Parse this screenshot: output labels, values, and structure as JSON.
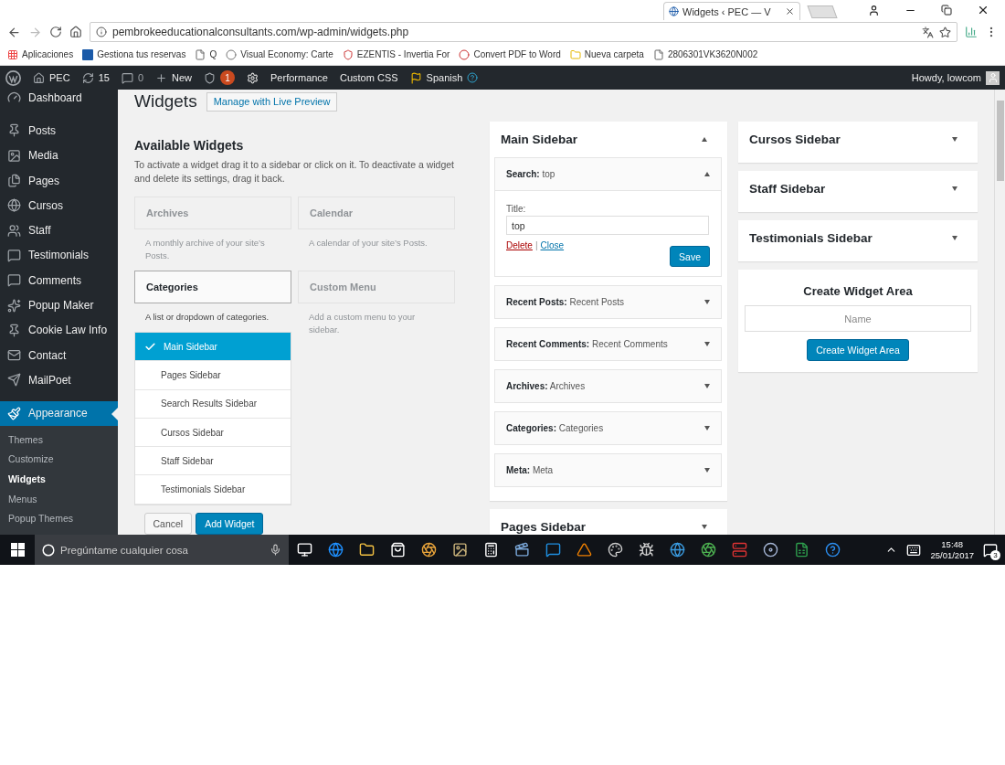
{
  "browser": {
    "tab_title": "Widgets ‹ PEC — V",
    "url": "pembrokeeducationalconsultants.com/wp-admin/widgets.php",
    "bookmarks": [
      "Aplicaciones",
      "Gestiona tus reservas",
      "Q",
      "Visual Economy: Carte",
      "EZENTIS - Invertia For",
      "Convert PDF to Word",
      "Nueva carpeta",
      "2806301VK3620N002"
    ]
  },
  "admin_bar": {
    "site": "PEC",
    "updates": "15",
    "comments": "0",
    "new": "New",
    "seo_badge": "1",
    "links": [
      "Performance",
      "Custom CSS"
    ],
    "language": "Spanish",
    "howdy": "Howdy, lowcom"
  },
  "menu": {
    "items": [
      {
        "label": "Dashboard",
        "selected": false
      },
      {
        "label": "Posts",
        "selected": false
      },
      {
        "label": "Media",
        "selected": false
      },
      {
        "label": "Pages",
        "selected": false
      },
      {
        "label": "Cursos",
        "selected": false
      },
      {
        "label": "Staff",
        "selected": false
      },
      {
        "label": "Testimonials",
        "selected": false
      },
      {
        "label": "Comments",
        "selected": false
      },
      {
        "label": "Popup Maker",
        "selected": false
      },
      {
        "label": "Cookie Law Info",
        "selected": false
      },
      {
        "label": "Contact",
        "selected": false
      },
      {
        "label": "MailPoet",
        "selected": false
      },
      {
        "label": "Appearance",
        "selected": true
      }
    ],
    "submenu": [
      {
        "label": "Themes",
        "selected": false
      },
      {
        "label": "Customize",
        "selected": false
      },
      {
        "label": "Widgets",
        "selected": true
      },
      {
        "label": "Menus",
        "selected": false
      },
      {
        "label": "Popup Themes",
        "selected": false
      }
    ]
  },
  "page": {
    "title": "Widgets",
    "live_preview": "Manage with Live Preview"
  },
  "available": {
    "title": "Available Widgets",
    "description": "To activate a widget drag it to a sidebar or click on it. To deactivate a widget and delete its settings, drag it back.",
    "widgets": [
      {
        "name": "Archives",
        "description": "A monthly archive of your site’s Posts.",
        "highlighted": false
      },
      {
        "name": "Calendar",
        "description": "A calendar of your site’s Posts.",
        "highlighted": false
      },
      {
        "name": "Categories",
        "description": "A list or dropdown of categories.",
        "highlighted": true
      },
      {
        "name": "Custom Menu",
        "description": "Add a custom menu to your sidebar.",
        "highlighted": false
      }
    ],
    "chooser": [
      {
        "label": "Main Sidebar",
        "selected": true
      },
      {
        "label": "Pages Sidebar",
        "selected": false
      },
      {
        "label": "Search Results Sidebar",
        "selected": false
      },
      {
        "label": "Cursos Sidebar",
        "selected": false
      },
      {
        "label": "Staff Sidebar",
        "selected": false
      },
      {
        "label": "Testimonials Sidebar",
        "selected": false
      }
    ],
    "cancel": "Cancel",
    "add": "Add Widget"
  },
  "sidebar_columns": [
    {
      "sidebars": [
        {
          "name": "Main Sidebar",
          "expanded": true,
          "widgets": [
            {
              "type": "Search:",
              "title": "top",
              "expanded": true,
              "form": {
                "label": "Title:",
                "value": "top",
                "delete": "Delete",
                "separator": "|",
                "close": "Close",
                "save": "Save"
              }
            },
            {
              "type": "Recent Posts:",
              "title": "Recent Posts",
              "expanded": false
            },
            {
              "type": "Recent Comments:",
              "title": "Recent Comments",
              "expanded": false
            },
            {
              "type": "Archives:",
              "title": "Archives",
              "expanded": false
            },
            {
              "type": "Categories:",
              "title": "Categories",
              "expanded": false
            },
            {
              "type": "Meta:",
              "title": "Meta",
              "expanded": false
            }
          ]
        },
        {
          "name": "Pages Sidebar",
          "expanded": false
        }
      ]
    },
    {
      "sidebars": [
        {
          "name": "Cursos Sidebar",
          "expanded": false
        },
        {
          "name": "Staff Sidebar",
          "expanded": false
        },
        {
          "name": "Testimonials Sidebar",
          "expanded": false
        }
      ],
      "create_area": {
        "title": "Create Widget Area",
        "placeholder": "Name",
        "button": "Create Widget Area"
      }
    }
  ],
  "taskbar": {
    "search_placeholder": "Pregúntame cualquier cosa",
    "time": "15:48",
    "date": "25/01/2017",
    "notifications": "3"
  }
}
